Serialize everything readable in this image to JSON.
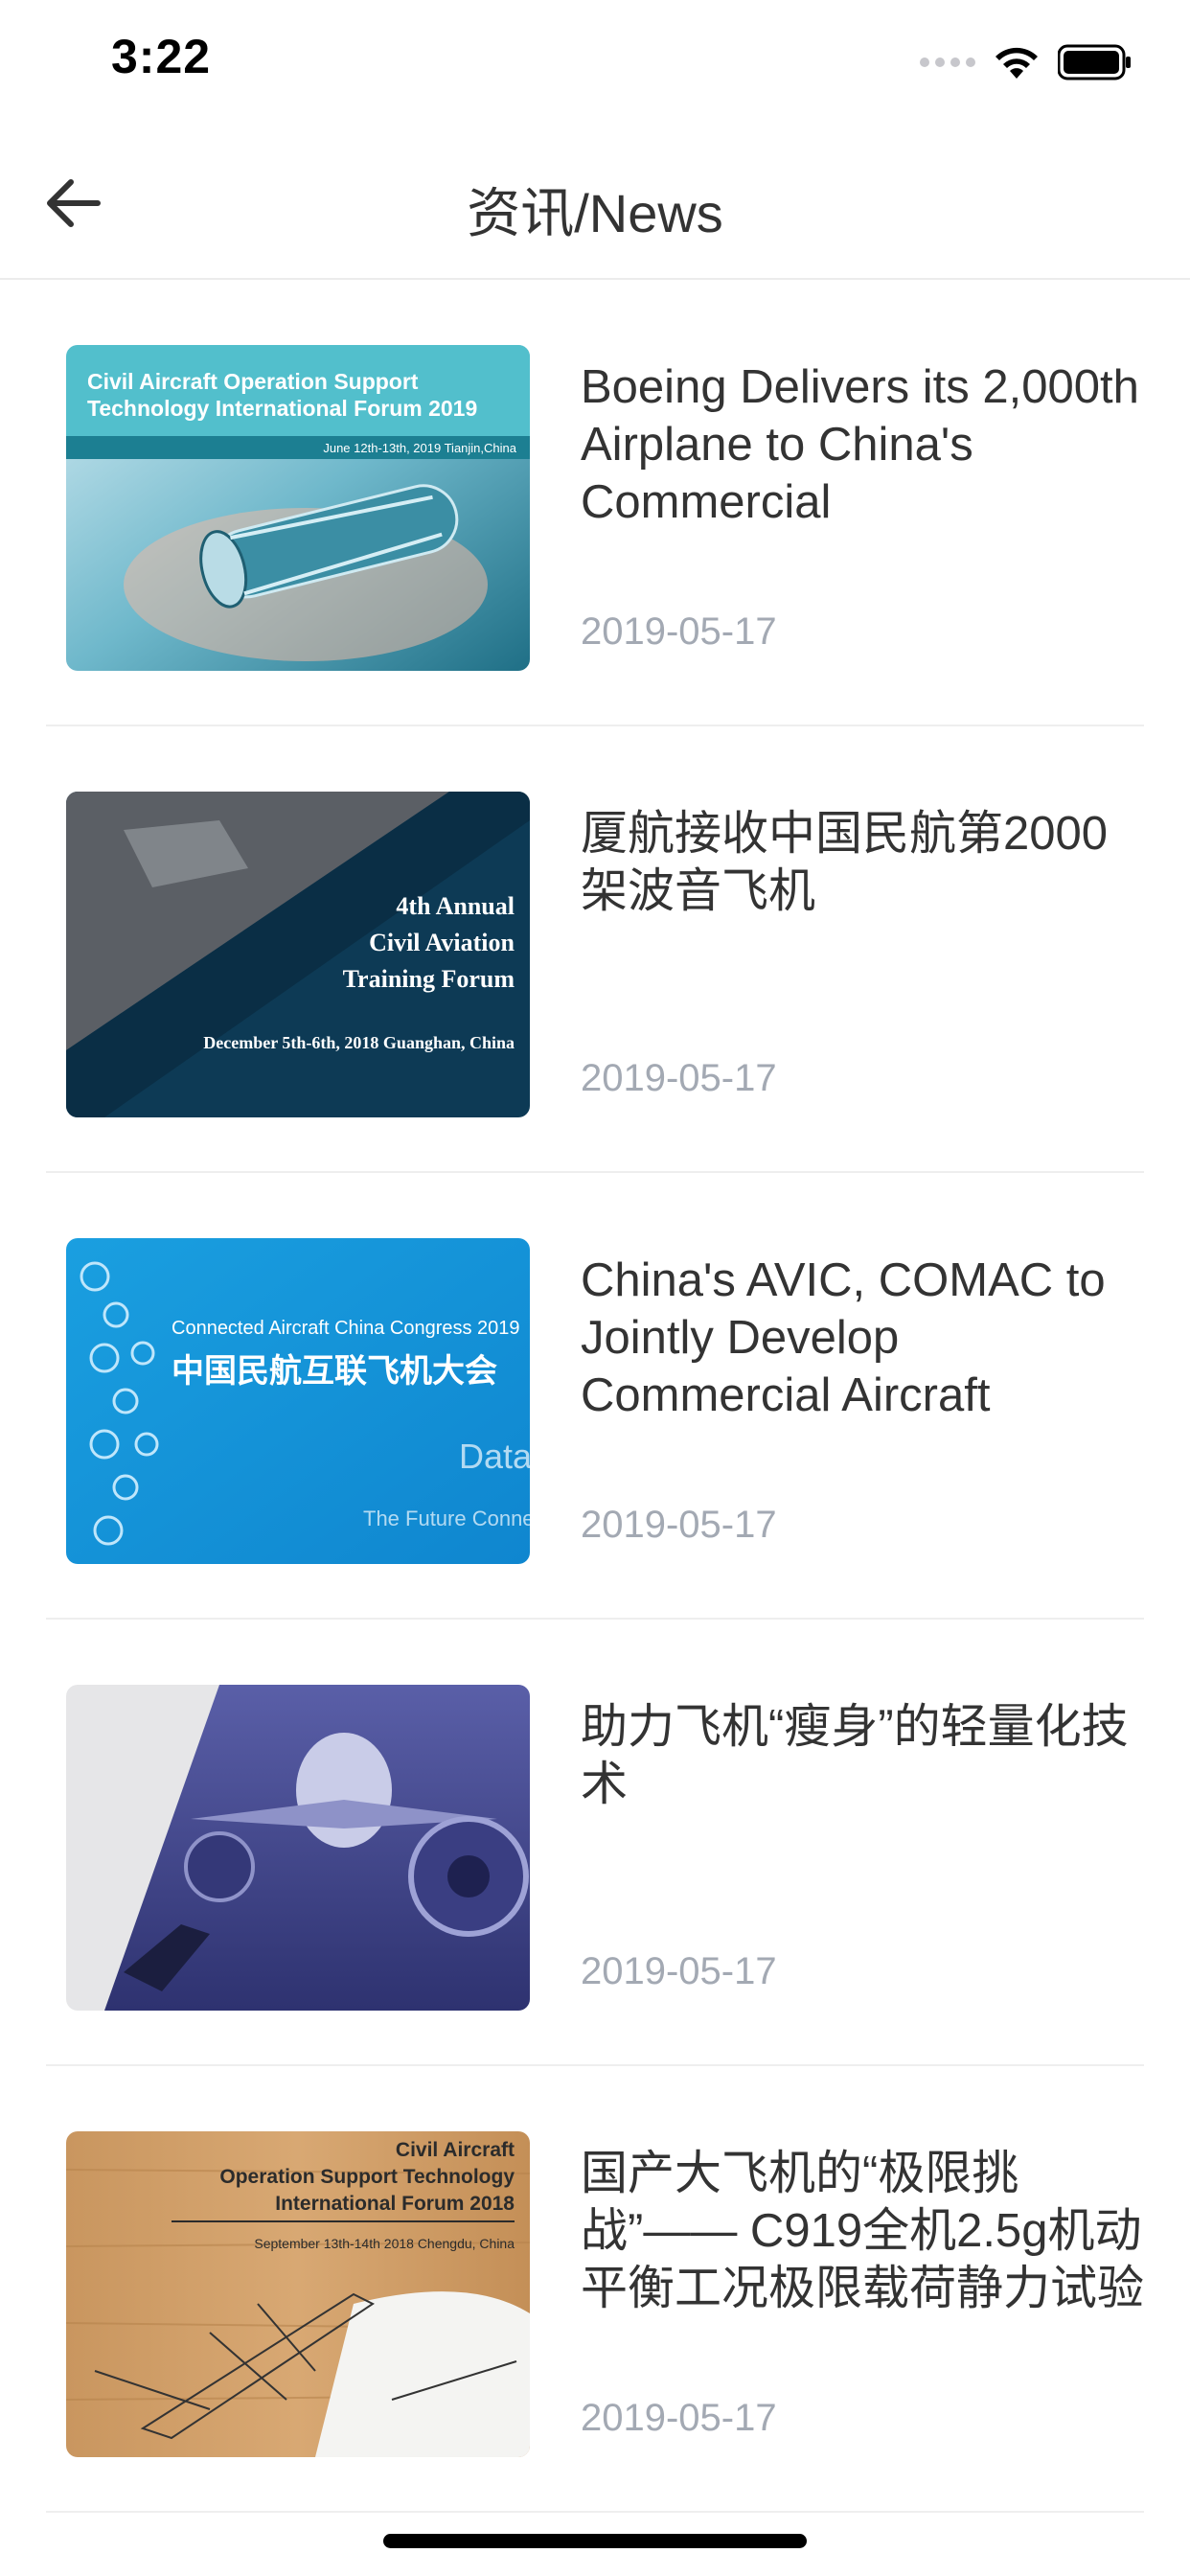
{
  "status_bar": {
    "time": "3:22",
    "icons": [
      "cellular-signal-icon",
      "wifi-icon",
      "battery-icon"
    ]
  },
  "nav": {
    "title": "资讯/News",
    "back_icon": "arrow-left-icon"
  },
  "news": [
    {
      "title": "Boeing Delivers its 2,000th Airplane to China's Commercial",
      "date": "2019-05-17",
      "thumb": {
        "line1": "Civil Aircraft Operation Support",
        "line2": "Technology International Forum 2019",
        "line3": "June 12th-13th, 2019   Tianjin,China"
      }
    },
    {
      "title": "厦航接收中国民航第2000架波音飞机",
      "date": "2019-05-17",
      "thumb": {
        "line1": "4th Annual",
        "line2": "Civil Aviation",
        "line3": "Training Forum",
        "line4": "December 5th-6th, 2018  Guanghan, China"
      }
    },
    {
      "title": "China's AVIC, COMAC to Jointly Develop Commercial Aircraft",
      "date": "2019-05-17",
      "thumb": {
        "line1": "Connected Aircraft China Congress 2019",
        "line2": "中国民航互联飞机大会",
        "line3": "Data",
        "line4": "The Future Connected"
      }
    },
    {
      "title": "助力飞机“瘦身”的轻量化技术",
      "date": "2019-05-17",
      "thumb": {}
    },
    {
      "title": "国产大飞机的“极限挑战”—— C919全机2.5g机动平衡工况极限载荷静力试验",
      "date": "2019-05-17",
      "thumb": {
        "line1": "Civil Aircraft",
        "line2": "Operation Support Technology",
        "line3": "International Forum 2018",
        "line4": "September 13th-14th 2018   Chengdu, China"
      }
    }
  ],
  "colors": {
    "title_text": "#333333",
    "date_text": "#a3a9b3",
    "divider": "#eeeeee"
  }
}
